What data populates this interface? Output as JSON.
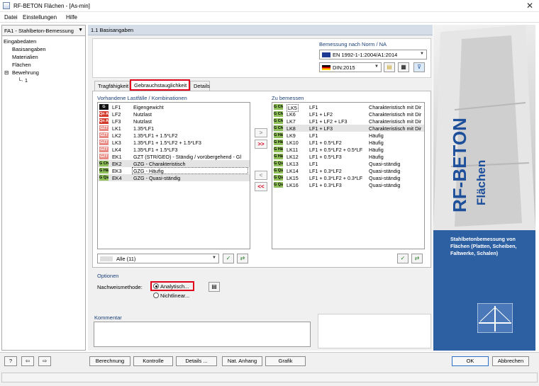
{
  "window": {
    "title": "RF-BETON Flächen - [As-min]"
  },
  "menu": [
    "Datei",
    "Einstellungen",
    "Hilfe"
  ],
  "case_selector": "FA1 - Stahlbeton-Bemessung",
  "tree": {
    "root": "Eingabedaten",
    "items": [
      "Basisangaben",
      "Materialien",
      "Flächen",
      "Bewehrung"
    ],
    "sub": "1"
  },
  "section_title": "1.1 Basisangaben",
  "norm": {
    "label": "Bemessung nach Norm / NA",
    "standard": "EN 1992-1-1:2004/A1:2014",
    "annex": "DIN:2015"
  },
  "tabs": [
    "Tragfähigkeit",
    "Gebrauchstauglichkeit",
    "Details"
  ],
  "available": {
    "title": "Vorhandene Lastfälle / Kombinationen",
    "rows": [
      {
        "badge": "G",
        "badge_color": "#111111",
        "id": "LF1",
        "desc": "Eigengewicht"
      },
      {
        "badge": "Qn A",
        "badge_color": "#d33a2c",
        "id": "LF2",
        "desc": "Nutzlast"
      },
      {
        "badge": "Qn A",
        "badge_color": "#d33a2c",
        "id": "LF3",
        "desc": "Nutzlast"
      },
      {
        "badge": "GZT",
        "badge_color": "#e88a83",
        "id": "LK1",
        "desc": "1.35*LF1"
      },
      {
        "badge": "GZT",
        "badge_color": "#e88a83",
        "id": "LK2",
        "desc": "1.35*LF1 + 1.5*LF2"
      },
      {
        "badge": "GZT",
        "badge_color": "#e88a83",
        "id": "LK3",
        "desc": "1.35*LF1 + 1.5*LF2 + 1.5*LF3"
      },
      {
        "badge": "GZT",
        "badge_color": "#e88a83",
        "id": "LK4",
        "desc": "1.35*LF1 + 1.5*LF3"
      },
      {
        "badge": "GZT",
        "badge_color": "#e88a83",
        "id": "EK1",
        "desc": "GZT (STR/GEO) - Ständig / vorübergehend - Gl"
      },
      {
        "badge": "G Ch",
        "badge_color": "#8fbf58",
        "id": "EK2",
        "desc": "GZG - Charakteristisch"
      },
      {
        "badge": "G Hä",
        "badge_color": "#8fbf58",
        "id": "EK3",
        "desc": "GZG - Häufig"
      },
      {
        "badge": "G Qs",
        "badge_color": "#8fbf58",
        "id": "EK4",
        "desc": "GZG - Quasi-ständig"
      }
    ],
    "filter": "Alle (11)"
  },
  "to_design": {
    "title": "Zu bemessen",
    "rows": [
      {
        "badge": "G Ch",
        "id": "LK5",
        "formula": "LF1",
        "type": "Charakteristisch mit Dir"
      },
      {
        "badge": "G Ch",
        "id": "LK6",
        "formula": "LF1 + LF2",
        "type": "Charakteristisch mit Dir"
      },
      {
        "badge": "G Ch",
        "id": "LK7",
        "formula": "LF1 + LF2 + LF3",
        "type": "Charakteristisch mit Dir"
      },
      {
        "badge": "G Ch",
        "id": "LK8",
        "formula": "LF1 + LF3",
        "type": "Charakteristisch mit Dir"
      },
      {
        "badge": "G Hä",
        "id": "LK9",
        "formula": "LF1",
        "type": "Häufig"
      },
      {
        "badge": "G Hä",
        "id": "LK10",
        "formula": "LF1 + 0.5*LF2",
        "type": "Häufig"
      },
      {
        "badge": "G Hä",
        "id": "LK11",
        "formula": "LF1 + 0.5*LF2 + 0.5*LF",
        "type": "Häufig"
      },
      {
        "badge": "G Hä",
        "id": "LK12",
        "formula": "LF1 + 0.5*LF3",
        "type": "Häufig"
      },
      {
        "badge": "G Qs",
        "id": "LK13",
        "formula": "LF1",
        "type": "Quasi-ständig"
      },
      {
        "badge": "G Qs",
        "id": "LK14",
        "formula": "LF1 + 0.3*LF2",
        "type": "Quasi-ständig"
      },
      {
        "badge": "G Qs",
        "id": "LK15",
        "formula": "LF1 + 0.3*LF2 + 0.3*LF",
        "type": "Quasi-ständig"
      },
      {
        "badge": "G Qs",
        "id": "LK16",
        "formula": "LF1 + 0.3*LF3",
        "type": "Quasi-ständig"
      }
    ]
  },
  "options": {
    "title": "Optionen",
    "method_label": "Nachweismethode:",
    "analytical": "Analytisch...",
    "nonlinear": "Nichtlinear..."
  },
  "comment_label": "Kommentar",
  "banner": {
    "title": "RF-BETON",
    "subtitle": "Flächen",
    "description": "Stahlbetonbemessung von Flächen (Platten, Scheiben, Faltwerke, Schalen)"
  },
  "buttons": {
    "calc": "Berechnung",
    "check": "Kontrolle",
    "details": "Details ...",
    "annex": "Nat. Anhang",
    "graphic": "Grafik",
    "ok": "OK",
    "cancel": "Abbrechen"
  },
  "colors": {
    "accent_red": "#e0001a",
    "banner_blue": "#2d5fa3",
    "title_blue": "#1d4f9a"
  }
}
